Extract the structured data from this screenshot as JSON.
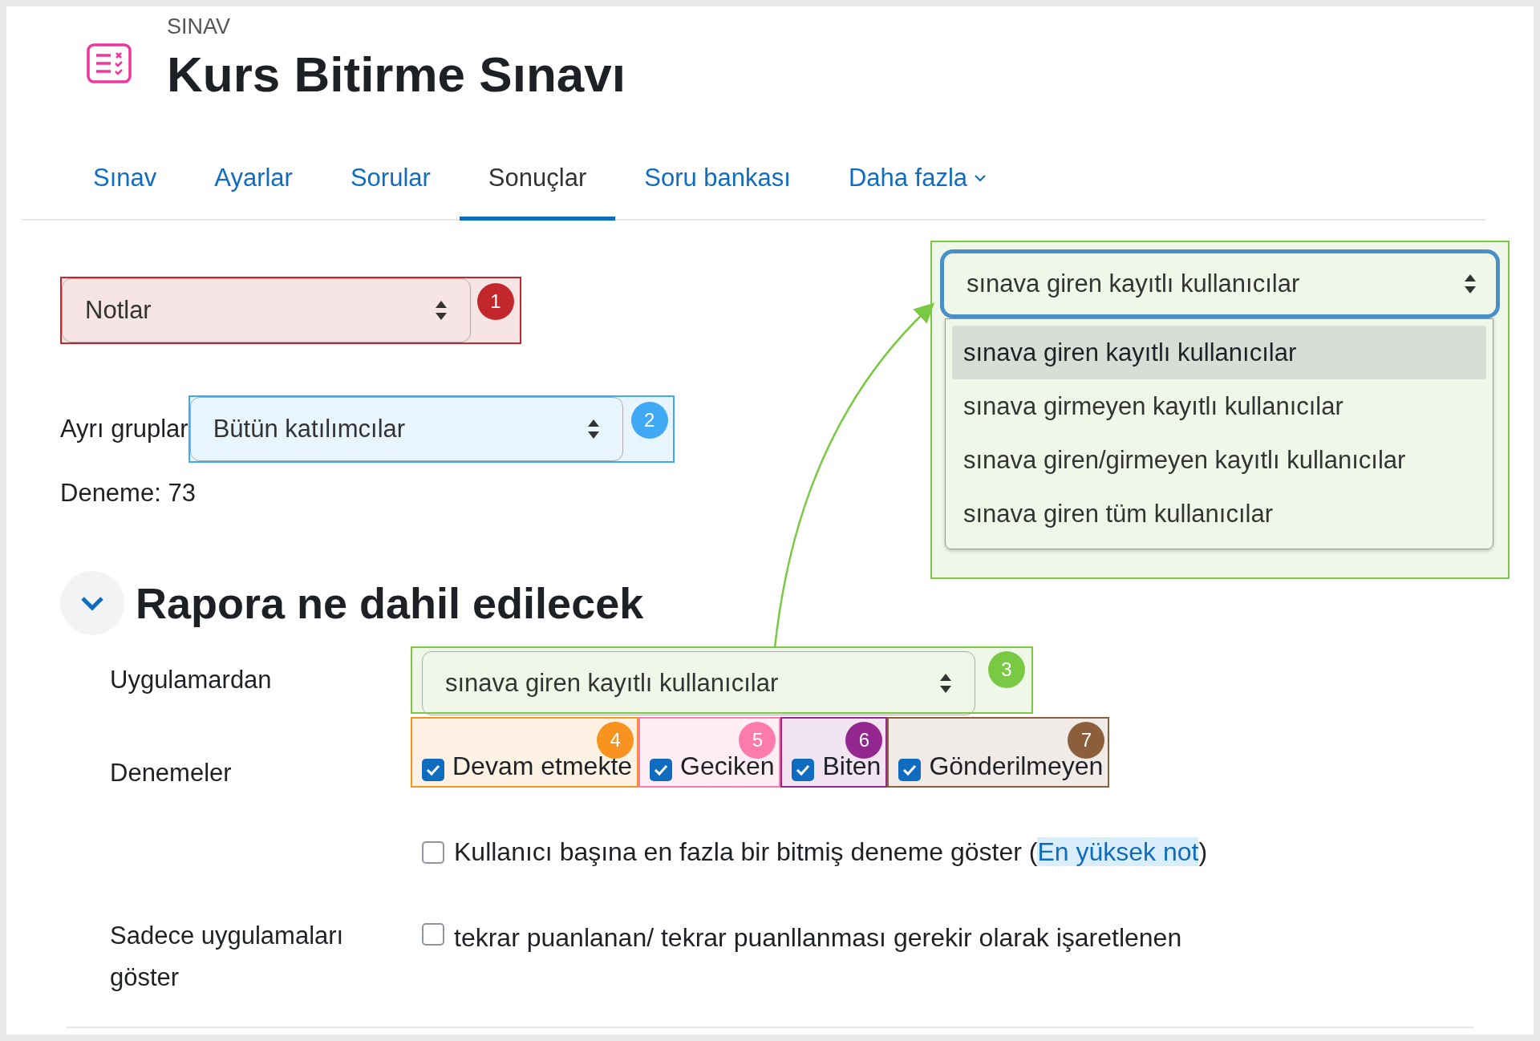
{
  "header": {
    "kicker": "SINAV",
    "title": "Kurs Bitirme Sınavı"
  },
  "tabs": [
    {
      "label": "Sınav",
      "selected": false,
      "kind": "link"
    },
    {
      "label": "Ayarlar",
      "selected": false,
      "kind": "link"
    },
    {
      "label": "Sorular",
      "selected": false,
      "kind": "link"
    },
    {
      "label": "Sonuçlar",
      "selected": true,
      "kind": "link"
    },
    {
      "label": "Soru bankası",
      "selected": false,
      "kind": "link"
    },
    {
      "label": "Daha fazla",
      "selected": false,
      "kind": "dropdown"
    }
  ],
  "report_select": {
    "value": "Notlar",
    "badge": "1",
    "color": "#c1272d"
  },
  "groups": {
    "label": "Ayrı gruplar",
    "value": "Bütün katılımcılar",
    "badge": "2",
    "color": "#3fa9f5"
  },
  "attempt_count": "Deneme: 73",
  "section": {
    "title": "Rapora ne dahil edilecek",
    "expanded": true
  },
  "from_users": {
    "label": "Uygulamardan",
    "value": "sınava giren kayıtlı kullanıcılar",
    "badge": "3",
    "color": "#7ac943"
  },
  "attempts": {
    "label": "Denemeler",
    "options": [
      {
        "label": "Devam etmekte",
        "checked": true,
        "badge": "4",
        "color": "#f7931e"
      },
      {
        "label": "Geciken",
        "checked": true,
        "badge": "5",
        "color": "#ff7bac"
      },
      {
        "label": "Biten",
        "checked": true,
        "badge": "6",
        "color": "#93278f"
      },
      {
        "label": "Gönderilmeyen",
        "checked": true,
        "badge": "7",
        "color": "#8b5e3c"
      }
    ]
  },
  "one_per_user": {
    "checked": false,
    "text": "Kullanıcı başına en fazla bir bitmiş deneme göster (",
    "link": "En yüksek not",
    "suffix": ")"
  },
  "only_regraded": {
    "label": "Sadece uygulamaları göster",
    "checked": false,
    "text": "tekrar puanlanan/ tekrar puanllanması gerekir olarak işaretlenen"
  },
  "dropdown_callout": {
    "value": "sınava giren kayıtlı kullanıcılar",
    "color": "#7ac943",
    "options": [
      {
        "label": "sınava giren kayıtlı kullanıcılar",
        "selected": true
      },
      {
        "label": "sınava girmeyen kayıtlı kullanıcılar",
        "selected": false
      },
      {
        "label": "sınava giren/girmeyen kayıtlı kullanıcılar",
        "selected": false
      },
      {
        "label": "sınava giren tüm kullanıcılar",
        "selected": false
      }
    ]
  }
}
